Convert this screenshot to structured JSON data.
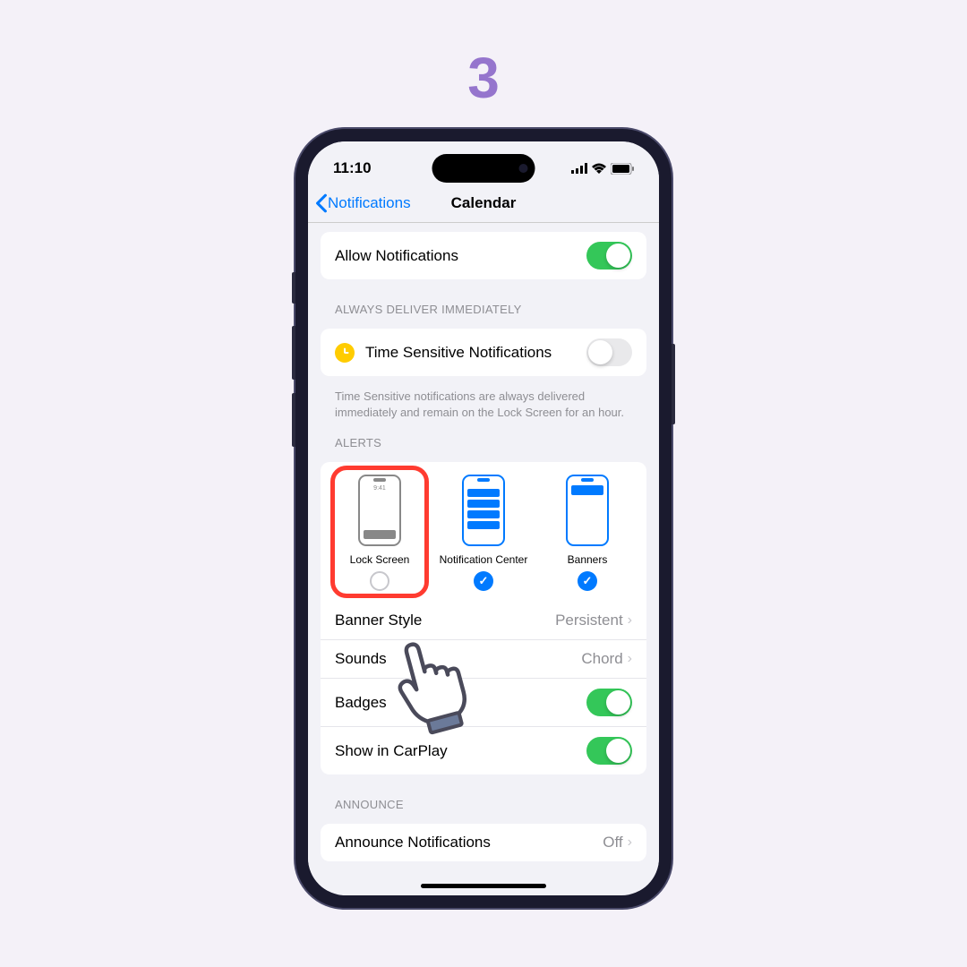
{
  "step": "3",
  "statusBar": {
    "time": "11:10"
  },
  "nav": {
    "back": "Notifications",
    "title": "Calendar"
  },
  "allowNotifications": {
    "label": "Allow Notifications",
    "enabled": true
  },
  "timeSensitive": {
    "header": "ALWAYS DELIVER IMMEDIATELY",
    "label": "Time Sensitive Notifications",
    "enabled": false,
    "footer": "Time Sensitive notifications are always delivered immediately and remain on the Lock Screen for an hour."
  },
  "alerts": {
    "header": "ALERTS",
    "lockScreen": {
      "label": "Lock Screen",
      "previewTime": "9:41",
      "checked": false
    },
    "notificationCenter": {
      "label": "Notification Center",
      "checked": true
    },
    "banners": {
      "label": "Banners",
      "checked": true
    }
  },
  "bannerStyle": {
    "label": "Banner Style",
    "value": "Persistent"
  },
  "sounds": {
    "label": "Sounds",
    "value": "Chord"
  },
  "badges": {
    "label": "Badges",
    "enabled": true
  },
  "carPlay": {
    "label": "Show in CarPlay",
    "enabled": true
  },
  "announce": {
    "header": "ANNOUNCE",
    "label": "Announce Notifications",
    "value": "Off"
  }
}
